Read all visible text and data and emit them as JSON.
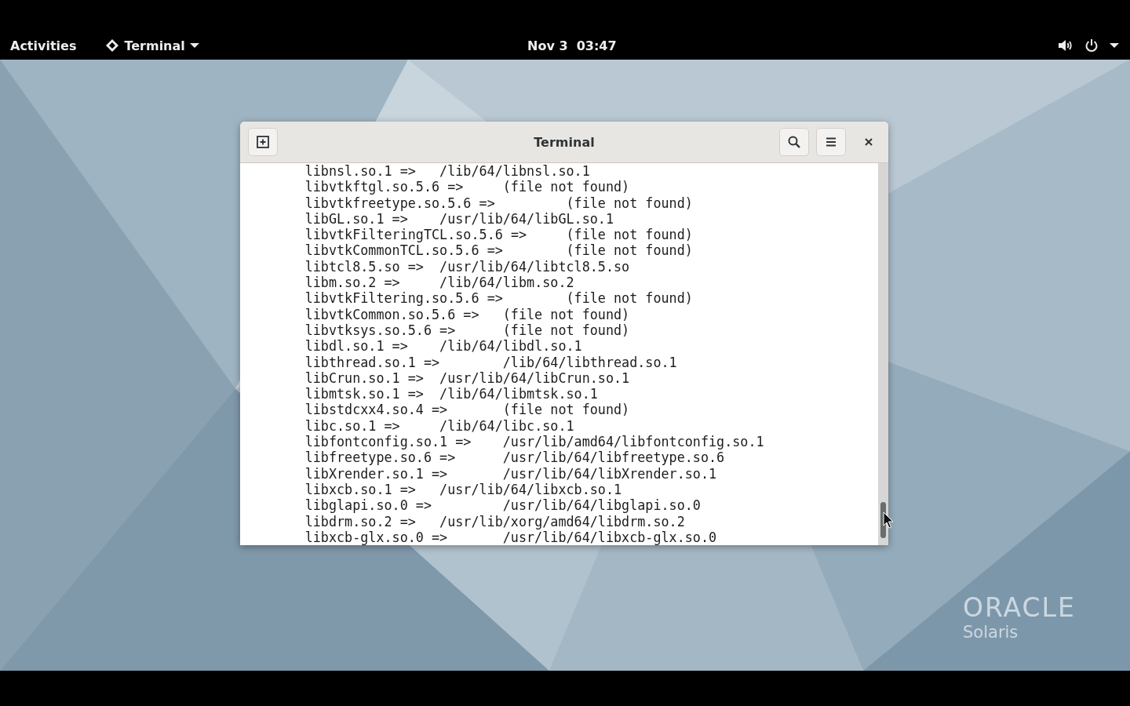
{
  "top_bar": {
    "activities": "Activities",
    "app_menu": "Terminal",
    "clock": "Nov 3  03:47"
  },
  "window": {
    "title": "Terminal",
    "lines": [
      "\tlibnsl.so.1 =>\t /lib/64/libnsl.so.1",
      "\tlibvtkftgl.so.5.6 =>\t (file not found)",
      "\tlibvtkfreetype.so.5.6 =>\t (file not found)",
      "\tlibGL.so.1 =>\t /usr/lib/64/libGL.so.1",
      "\tlibvtkFilteringTCL.so.5.6 =>\t (file not found)",
      "\tlibvtkCommonTCL.so.5.6 =>\t (file not found)",
      "\tlibtcl8.5.so =>\t /usr/lib/64/libtcl8.5.so",
      "\tlibm.so.2 =>\t /lib/64/libm.so.2",
      "\tlibvtkFiltering.so.5.6 =>\t (file not found)",
      "\tlibvtkCommon.so.5.6 =>\t (file not found)",
      "\tlibvtksys.so.5.6 =>\t (file not found)",
      "\tlibdl.so.1 =>\t /lib/64/libdl.so.1",
      "\tlibthread.so.1 =>\t /lib/64/libthread.so.1",
      "\tlibCrun.so.1 =>\t /usr/lib/64/libCrun.so.1",
      "\tlibmtsk.so.1 =>\t /lib/64/libmtsk.so.1",
      "\tlibstdcxx4.so.4 =>\t (file not found)",
      "\tlibc.so.1 =>\t /lib/64/libc.so.1",
      "\tlibfontconfig.so.1 =>\t /usr/lib/amd64/libfontconfig.so.1",
      "\tlibfreetype.so.6 =>\t /usr/lib/64/libfreetype.so.6",
      "\tlibXrender.so.1 =>\t /usr/lib/64/libXrender.so.1",
      "\tlibxcb.so.1 =>\t /usr/lib/64/libxcb.so.1",
      "\tlibglapi.so.0 =>\t /usr/lib/64/libglapi.so.0",
      "\tlibdrm.so.2 =>\t /usr/lib/xorg/amd64/libdrm.so.2",
      "\tlibxcb-glx.so.0 =>\t /usr/lib/64/libxcb-glx.so.0"
    ]
  },
  "wallpaper_logo": {
    "brand": "ORACLE",
    "product": "Solaris"
  }
}
